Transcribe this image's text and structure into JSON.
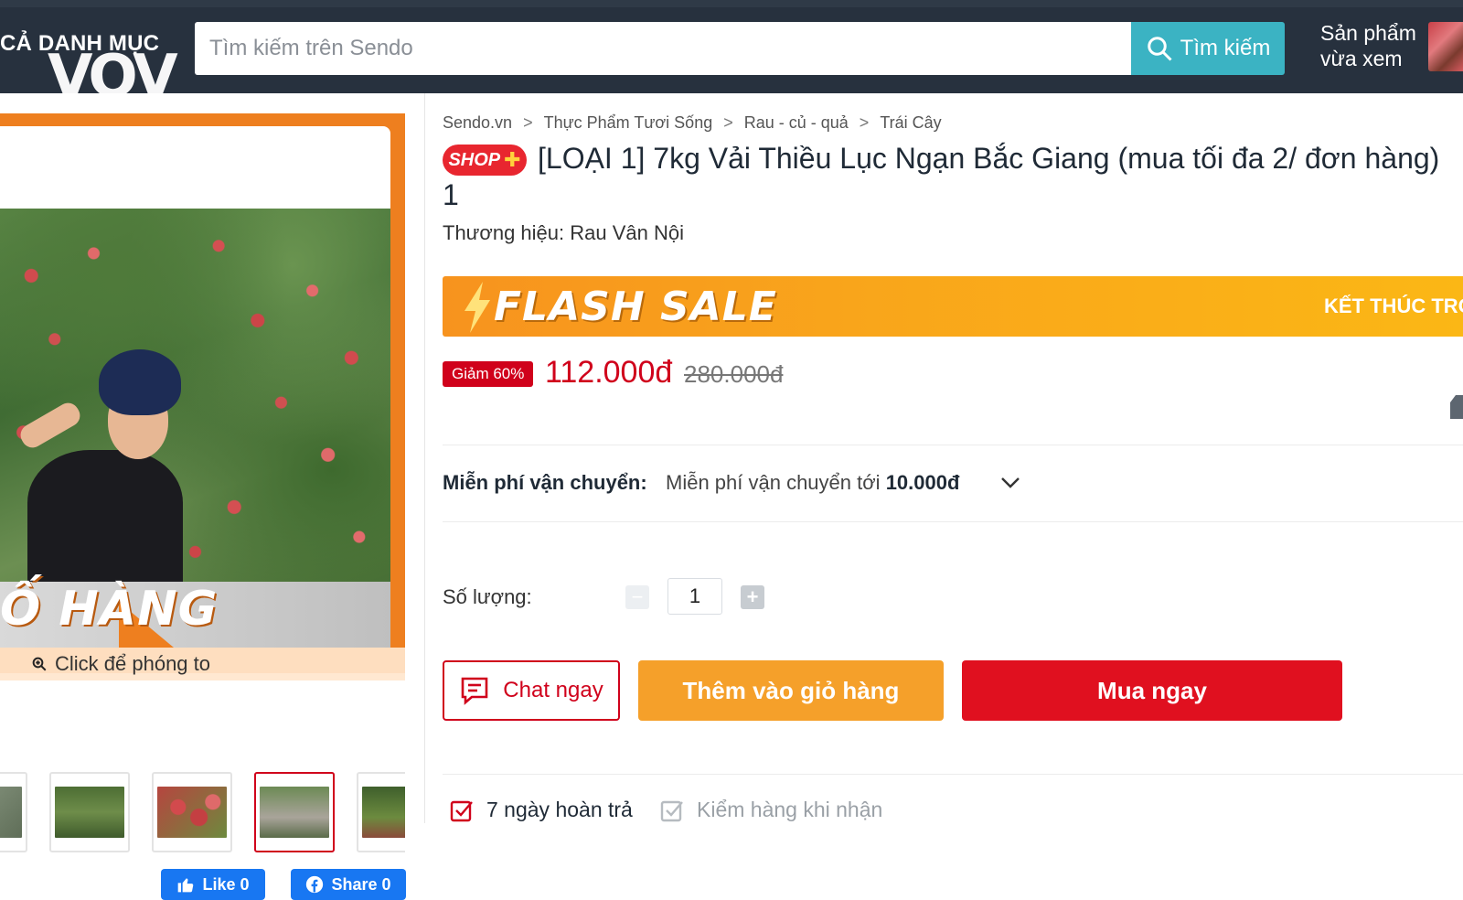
{
  "header": {
    "category_label": "CẢ DANH MỤC",
    "watermark": "VOV",
    "search": {
      "placeholder": "Tìm kiếm trên Sendo",
      "value": "",
      "button_label": "Tìm kiếm"
    },
    "recent_line1": "Sản phẩm",
    "recent_line2": "vừa xem"
  },
  "gallery": {
    "banner_text": "Ố HÀNG",
    "zoom_hint": "Click để phóng to",
    "thumbnails": [
      "thumb-1",
      "thumb-2",
      "thumb-3",
      "thumb-4",
      "thumb-5"
    ],
    "active_thumbnail_index": 3,
    "like_label": "Like 0",
    "share_label": "Share 0"
  },
  "breadcrumb": [
    "Sendo.vn",
    "Thực Phẩm Tươi Sống",
    "Rau - củ - quả",
    "Trái Cây"
  ],
  "breadcrumb_separator": ">",
  "product": {
    "shop_badge": "SHOP",
    "shop_badge_plus": "✚",
    "title": "[LOẠI 1] 7kg Vải Thiều Lục Ngạn Bắc Giang (mua tối đa 2/ đơn hàng) 1",
    "brand_label": "Thương hiệu:",
    "brand_name": "Rau Vân Nội",
    "flash_sale_label": "FLASH SALE",
    "flash_sale_ends": "KẾT THÚC TRO",
    "discount_badge": "Giảm 60%",
    "price": "112.000đ",
    "old_price": "280.000đ",
    "shipping_label": "Miễn phí vận chuyển:",
    "shipping_value_prefix": "Miễn phí vận chuyển tới",
    "shipping_value_amount": "10.000đ",
    "quantity_label": "Số lượng:",
    "quantity": "1",
    "qty_minus": "−",
    "qty_plus": "+"
  },
  "actions": {
    "chat_label": "Chat ngay",
    "add_to_cart_label": "Thêm vào giỏ hàng",
    "buy_now_label": "Mua ngay"
  },
  "policies": [
    {
      "label": "7 ngày hoàn trả",
      "enabled": true
    },
    {
      "label": "Kiểm hàng khi nhận",
      "enabled": false
    }
  ],
  "colors": {
    "header_bg": "#27313e",
    "search_button": "#3bb3c3",
    "brand_red": "#d0011b",
    "flash_orange": "#f7931e",
    "cart_orange": "#f5a02a",
    "buy_red": "#e0101f"
  }
}
